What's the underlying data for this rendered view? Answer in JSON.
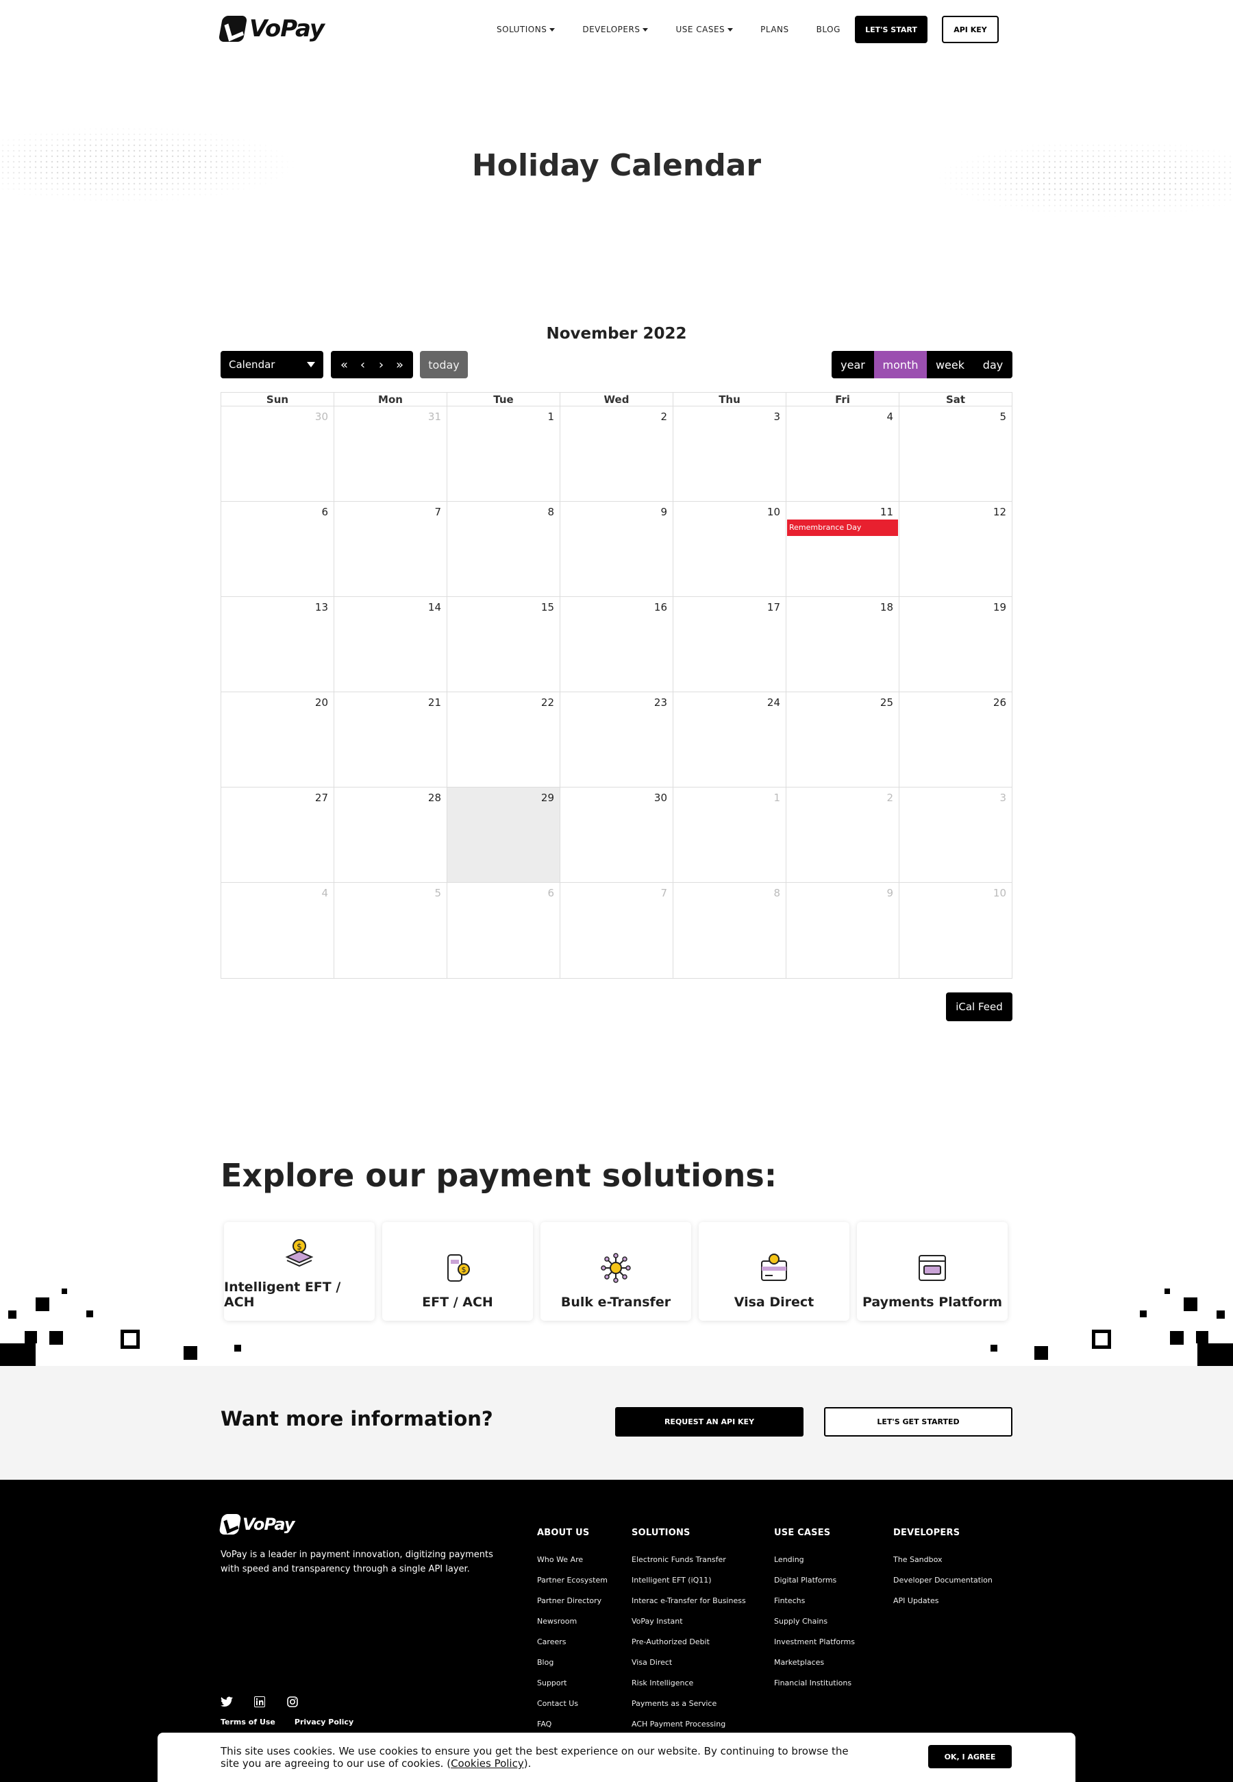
{
  "brand": {
    "name": "VoPay"
  },
  "nav": {
    "items": [
      "SOLUTIONS",
      "DEVELOPERS",
      "USE CASES",
      "PLANS",
      "BLOG"
    ],
    "start_label": "LET'S START",
    "apikey_label": "API KEY"
  },
  "hero": {
    "title": "Holiday Calendar"
  },
  "calendar": {
    "month_label": "November 2022",
    "select_value": "Calendar",
    "today_label": "today",
    "views": {
      "year": "year",
      "month": "month",
      "week": "week",
      "day": "day"
    },
    "active_view": "month",
    "days_of_week": [
      "Sun",
      "Mon",
      "Tue",
      "Wed",
      "Thu",
      "Fri",
      "Sat"
    ],
    "weeks": [
      [
        "30",
        "31",
        "1",
        "2",
        "3",
        "4",
        "5"
      ],
      [
        "6",
        "7",
        "8",
        "9",
        "10",
        "11",
        "12"
      ],
      [
        "13",
        "14",
        "15",
        "16",
        "17",
        "18",
        "19"
      ],
      [
        "20",
        "21",
        "22",
        "23",
        "24",
        "25",
        "26"
      ],
      [
        "27",
        "28",
        "29",
        "30",
        "1",
        "2",
        "3"
      ],
      [
        "4",
        "5",
        "6",
        "7",
        "8",
        "9",
        "10"
      ]
    ],
    "event": {
      "title": "Remembrance Day",
      "date": "11"
    },
    "ical_label": "iCal Feed"
  },
  "explore": {
    "title": "Explore our payment solutions:",
    "cards": [
      {
        "label": "Intelligent EFT / ACH",
        "icon": "coin-stack-icon"
      },
      {
        "label": "EFT / ACH",
        "icon": "phone-payment-icon"
      },
      {
        "label": "Bulk e-Transfer",
        "icon": "network-coin-icon"
      },
      {
        "label": "Visa Direct",
        "icon": "card-coin-icon"
      },
      {
        "label": "Payments Platform",
        "icon": "browser-window-icon"
      }
    ]
  },
  "cta": {
    "title": "Want more information?",
    "request_label": "REQUEST AN API KEY",
    "started_label": "LET'S GET STARTED"
  },
  "footer": {
    "description": "VoPay is a leader in payment innovation, digitizing payments with speed and transparency through a single API layer.",
    "columns": [
      {
        "title": "ABOUT US",
        "links": [
          "Who We Are",
          "Partner Ecosystem",
          "Partner Directory",
          "Newsroom",
          "Careers",
          "Blog",
          "Support",
          "Contact Us",
          "FAQ"
        ]
      },
      {
        "title": "SOLUTIONS",
        "links": [
          "Electronic Funds Transfer",
          "Intelligent EFT (iQ11)",
          "Interac e-Transfer for Business",
          "VoPay Instant",
          "Pre-Authorized Debit",
          "Visa Direct",
          "Risk Intelligence",
          "Payments as a Service",
          "ACH Payment Processing"
        ]
      },
      {
        "title": "USE CASES",
        "links": [
          "Lending",
          "Digital Platforms",
          "Fintechs",
          "Supply Chains",
          "Investment Platforms",
          "Marketplaces",
          "Financial Institutions"
        ]
      },
      {
        "title": "DEVELOPERS",
        "links": [
          "The Sandbox",
          "Developer Documentation",
          "API Updates"
        ]
      }
    ],
    "terms_label": "Terms of Use",
    "privacy_label": "Privacy Policy",
    "social": [
      "twitter-icon",
      "linkedin-icon",
      "instagram-icon"
    ]
  },
  "cookie": {
    "text": "This site uses cookies. We use cookies to ensure you get the best experience on our website. By continuing to browse the site you are agreeing to our use of cookies. (",
    "link": "Cookies Policy",
    "text_end": ").",
    "accept_label": "OK, I AGREE"
  },
  "colors": {
    "accent_purple": "#9b4fb0",
    "event_red": "#e8202f",
    "today_bg": "#ececec"
  }
}
